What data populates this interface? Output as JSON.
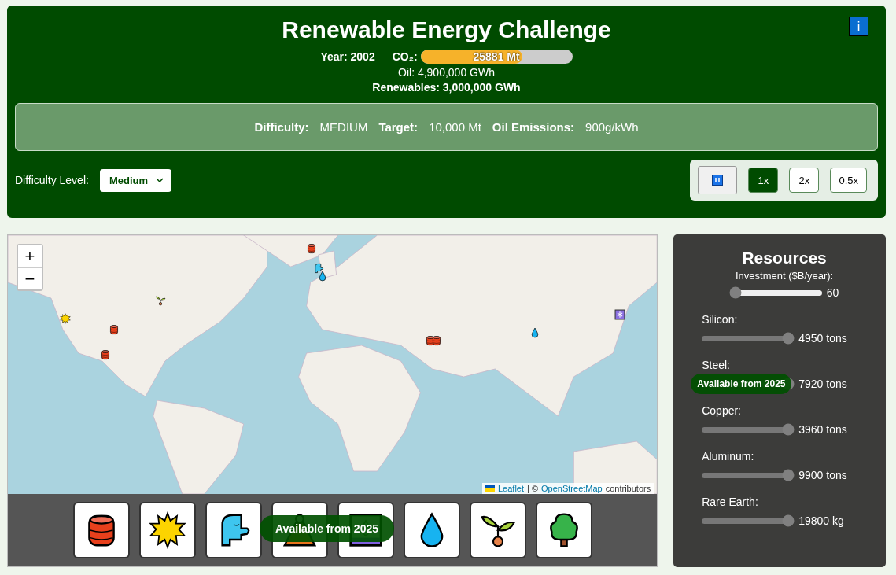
{
  "header": {
    "title": "Renewable Energy Challenge",
    "info_button": "i",
    "year": "Year: 2002",
    "co2_label": "CO₂:",
    "co2": {
      "level": 0.67,
      "reading": "25881 Mt"
    },
    "oil": "Oil: 4,900,000 GWh",
    "renewables": "Renewables: 3,000,000 GWh"
  },
  "settings": [
    {
      "label": "Difficulty:",
      "value": "MEDIUM"
    },
    {
      "label": "Target:",
      "value": "10,000 Mt"
    },
    {
      "label": "Oil Emissions:",
      "value": "900g/kWh"
    }
  ],
  "difficulty_level": {
    "label": "Difficulty Level:",
    "value": "Medium"
  },
  "speeds": [
    {
      "label": "1x",
      "selected": true
    },
    {
      "label": "2x",
      "selected": false
    },
    {
      "label": "0.5x",
      "selected": false
    }
  ],
  "map": {
    "zoom_in": "+",
    "zoom_out": "−",
    "attribution": {
      "link_1": "Leaflet",
      "separator": "| ©",
      "link_2": "OpenStreetMap",
      "suffix": "contributors"
    },
    "markers": [
      {
        "kind": "oil"
      },
      {
        "kind": "wind"
      },
      {
        "kind": "hydro"
      },
      {
        "kind": "biomass"
      },
      {
        "kind": "solar"
      },
      {
        "kind": "oil"
      },
      {
        "kind": "oil"
      },
      {
        "kind": "oil"
      },
      {
        "kind": "oil"
      },
      {
        "kind": "hydro"
      },
      {
        "kind": "nuclear"
      }
    ]
  },
  "energy_sources": [
    {
      "kind": "oil"
    },
    {
      "kind": "solar"
    },
    {
      "kind": "wind"
    },
    {
      "kind": "geothermal"
    },
    {
      "kind": "framed"
    },
    {
      "kind": "hydro"
    },
    {
      "kind": "biomass"
    },
    {
      "kind": "forest"
    }
  ],
  "energy_tooltip": "Available from 2025",
  "resources": {
    "title": "Resources",
    "tooltip": "Available from 2025",
    "sliders": [
      {
        "kind": "investment",
        "label": "Investment ($B/year):",
        "level": 0,
        "reading": "60"
      },
      {
        "kind": "material",
        "label": "Silicon:",
        "level": 1,
        "reading": "4950 tons"
      },
      {
        "kind": "material",
        "label": "Steel:",
        "level": 1,
        "reading": "7920 tons"
      },
      {
        "kind": "material",
        "label": "Copper:",
        "level": 1,
        "reading": "3960 tons"
      },
      {
        "kind": "material",
        "label": "Aluminum:",
        "level": 1,
        "reading": "9900 tons"
      },
      {
        "kind": "material",
        "label": "Rare Earth:",
        "level": 1,
        "reading": "19800 kg"
      }
    ]
  }
}
